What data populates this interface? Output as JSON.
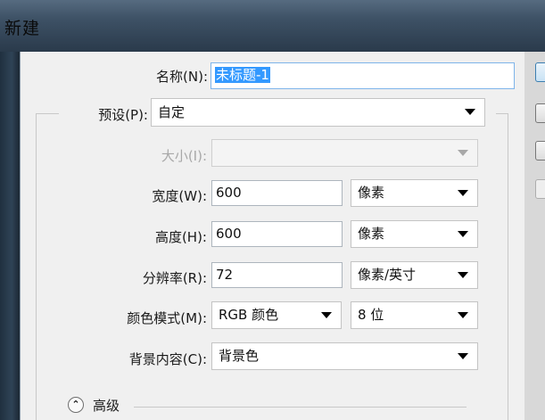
{
  "window": {
    "title": "新建"
  },
  "form": {
    "name_label": "名称(N):",
    "name_value": "未标题-1",
    "preset_label": "预设(P):",
    "preset_value": "自定",
    "size_label": "大小(I):",
    "size_value": "",
    "width_label": "宽度(W):",
    "width_value": "600",
    "width_unit": "像素",
    "height_label": "高度(H):",
    "height_value": "600",
    "height_unit": "像素",
    "resolution_label": "分辨率(R):",
    "resolution_value": "72",
    "resolution_unit": "像素/英寸",
    "color_mode_label": "颜色模式(M):",
    "color_mode_value": "RGB 颜色",
    "bit_depth_value": "8 位",
    "background_label": "背景内容(C):",
    "background_value": "背景色",
    "advanced_label": "高级",
    "advanced_icon": "double-chevron-up-icon"
  },
  "colors": {
    "selection": "#3399ff",
    "titlebar": "#3e5266"
  }
}
